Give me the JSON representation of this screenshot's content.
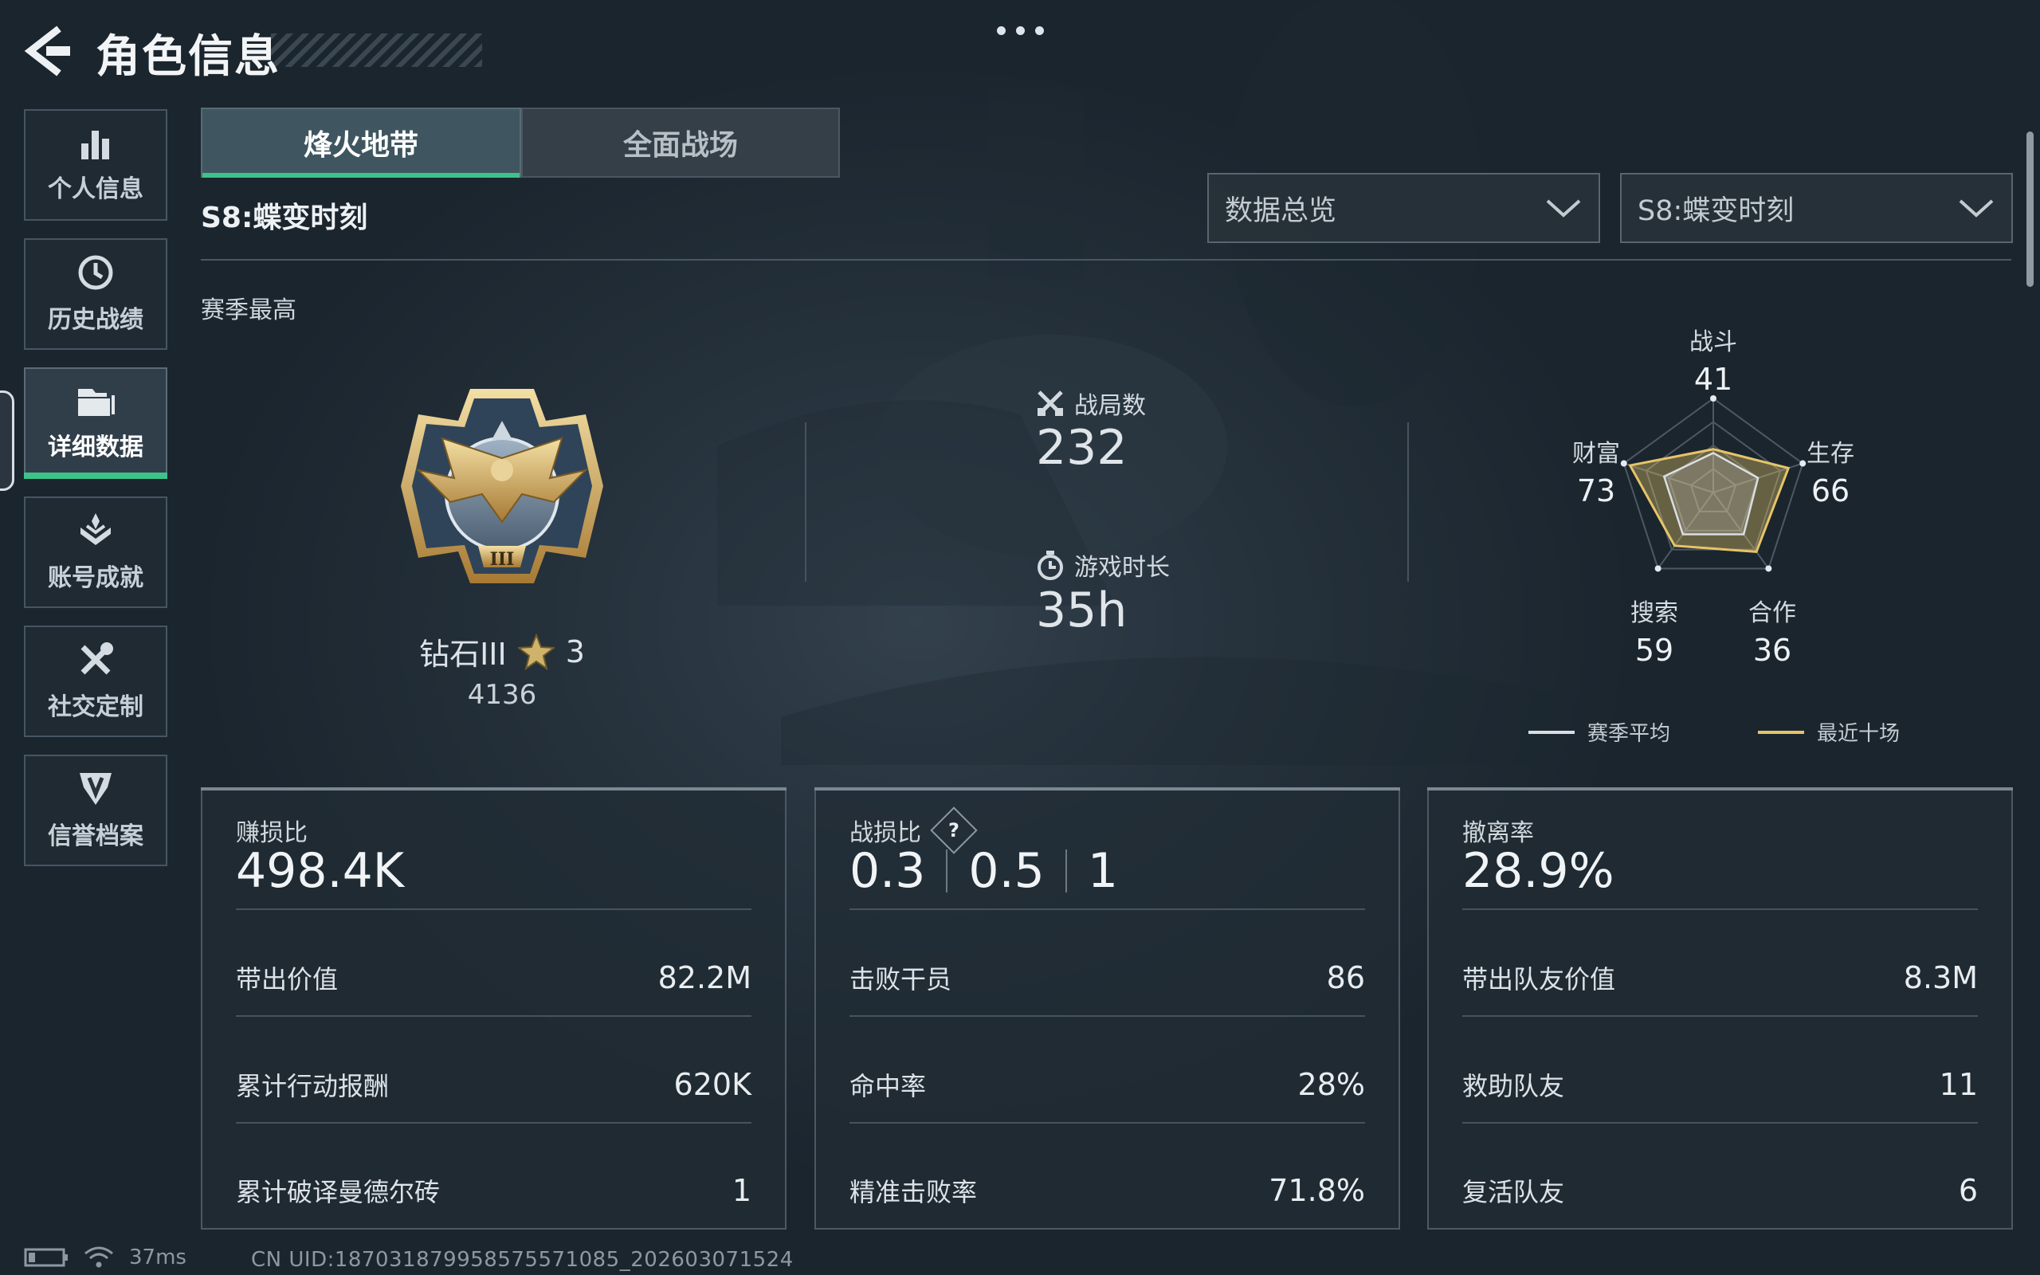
{
  "header": {
    "title": "角色信息"
  },
  "sidebar": {
    "items": [
      {
        "label": "个人信息",
        "icon": "bar-chart-icon"
      },
      {
        "label": "历史战绩",
        "icon": "history-clock-icon"
      },
      {
        "label": "详细数据",
        "icon": "folder-icon",
        "active": true
      },
      {
        "label": "账号成就",
        "icon": "achievement-icon"
      },
      {
        "label": "社交定制",
        "icon": "tools-icon"
      },
      {
        "label": "信誉档案",
        "icon": "credit-badge-icon"
      }
    ]
  },
  "tabs": [
    {
      "label": "烽火地带",
      "active": true
    },
    {
      "label": "全面战场"
    }
  ],
  "season": {
    "label": "S8:蝶变时刻",
    "best_label": "赛季最高"
  },
  "dropdowns": {
    "view": "数据总览",
    "season": "S8:蝶变时刻"
  },
  "rank": {
    "name": "钻石III",
    "stars": "3",
    "score": "4136"
  },
  "stats": {
    "matches": {
      "label": "战局数",
      "value": "232",
      "icon": "crossed-swords-icon"
    },
    "playtime": {
      "label": "游戏时长",
      "value": "35h",
      "icon": "stopwatch-icon"
    }
  },
  "radar": {
    "axes": [
      {
        "name": "战斗",
        "value": "41"
      },
      {
        "name": "生存",
        "value": "66"
      },
      {
        "name": "合作",
        "value": "36"
      },
      {
        "name": "搜索",
        "value": "59"
      },
      {
        "name": "财富",
        "value": "73"
      }
    ],
    "season_avg": [
      0.42,
      0.5,
      0.55,
      0.55,
      0.55
    ],
    "recent_ten": [
      0.46,
      0.84,
      0.78,
      0.7,
      0.93
    ],
    "legend": {
      "season_avg": "赛季平均",
      "recent_ten": "最近十场"
    },
    "colors": {
      "season_avg": "#d9dee2",
      "recent_ten": "#e6c468"
    }
  },
  "cards": {
    "profit": {
      "title": "赚损比",
      "big": "498.4K",
      "rows": [
        {
          "k": "带出价值",
          "v": "82.2M"
        },
        {
          "k": "累计行动报酬",
          "v": "620K"
        },
        {
          "k": "累计破译曼德尔砖",
          "v": "1"
        }
      ]
    },
    "combat": {
      "title": "战损比",
      "help": "?",
      "ratios": [
        "0.3",
        "0.5",
        "1"
      ],
      "rows": [
        {
          "k": "击败干员",
          "v": "86"
        },
        {
          "k": "命中率",
          "v": "28%"
        },
        {
          "k": "精准击败率",
          "v": "71.8%"
        }
      ]
    },
    "extract": {
      "title": "撤离率",
      "big": "28.9%",
      "rows": [
        {
          "k": "带出队友价值",
          "v": "8.3M"
        },
        {
          "k": "救助队友",
          "v": "11"
        },
        {
          "k": "复活队友",
          "v": "6"
        }
      ]
    }
  },
  "status_bar": {
    "ping": "37ms",
    "uid": "CN UID:187031879958575571085_202603071524"
  },
  "colors": {
    "accent": "#3dc38a",
    "gold": "#e6c468"
  }
}
